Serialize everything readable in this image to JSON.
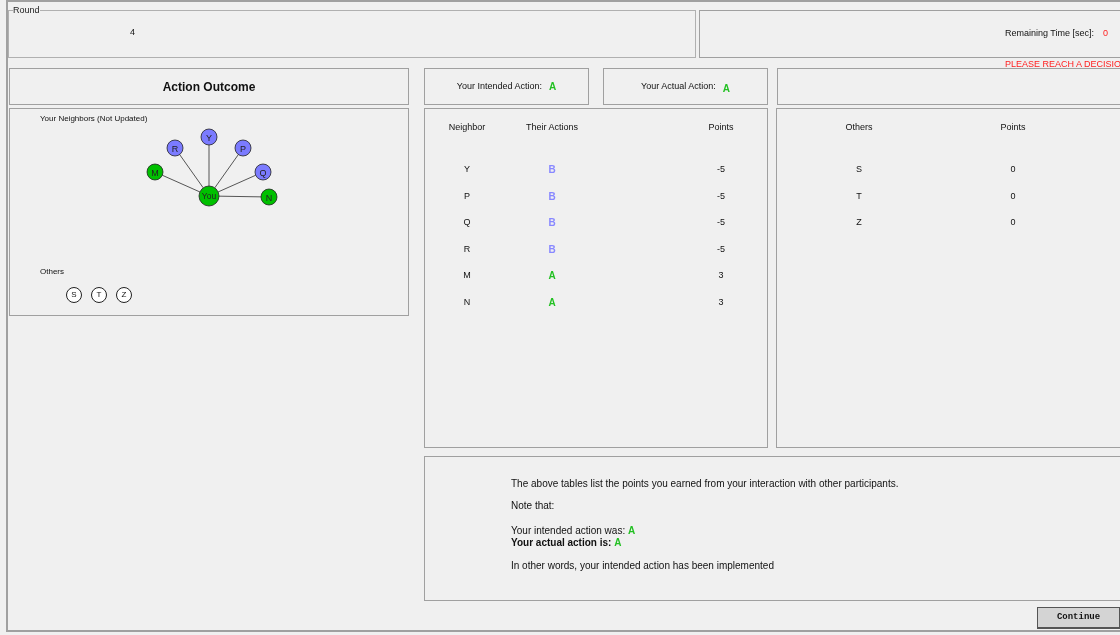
{
  "round": {
    "legend": "Round",
    "value": "4"
  },
  "timer": {
    "label": "Remaining Time [sec]:",
    "value": "0"
  },
  "warning": "PLEASE REACH A DECISIO",
  "outcome_title": "Action Outcome",
  "intended": {
    "label": "Your Intended Action:",
    "value": "A",
    "color": "#22c022"
  },
  "actual": {
    "label": "Your Actual Action:",
    "value": "A",
    "color": "#22c022"
  },
  "network": {
    "title": "Your Neighbors (Not Updated)",
    "center": {
      "label": "You",
      "color": "#00c000"
    },
    "neighbors": [
      {
        "label": "Y",
        "color": "#7b7bff"
      },
      {
        "label": "R",
        "color": "#7b7bff"
      },
      {
        "label": "P",
        "color": "#7b7bff"
      },
      {
        "label": "M",
        "color": "#00c000"
      },
      {
        "label": "Q",
        "color": "#7b7bff"
      },
      {
        "label": "N",
        "color": "#00c000"
      }
    ],
    "others_title": "Others",
    "others": [
      "S",
      "T",
      "Z"
    ]
  },
  "neighbor_table": {
    "columns": [
      "Neighbor",
      "Their Actions",
      "Points"
    ],
    "rows": [
      {
        "neighbor": "Y",
        "action": "B",
        "color": "#8888ff",
        "points": "-5"
      },
      {
        "neighbor": "P",
        "action": "B",
        "color": "#8888ff",
        "points": "-5"
      },
      {
        "neighbor": "Q",
        "action": "B",
        "color": "#8888ff",
        "points": "-5"
      },
      {
        "neighbor": "R",
        "action": "B",
        "color": "#8888ff",
        "points": "-5"
      },
      {
        "neighbor": "M",
        "action": "A",
        "color": "#22c022",
        "points": "3"
      },
      {
        "neighbor": "N",
        "action": "A",
        "color": "#22c022",
        "points": "3"
      }
    ]
  },
  "others_table": {
    "columns": [
      "Others",
      "Points"
    ],
    "rows": [
      {
        "name": "S",
        "points": "0"
      },
      {
        "name": "T",
        "points": "0"
      },
      {
        "name": "Z",
        "points": "0"
      }
    ]
  },
  "message": {
    "intro": "The above tables list the points you earned from your interaction with other participants.",
    "note": "Note that:",
    "results": [
      {
        "text": "Your intended action was:",
        "value": "A",
        "color": "#22c022",
        "bold": false
      },
      {
        "text": "Your actual action is:",
        "value": "A",
        "color": "#22c022",
        "bold": true
      }
    ],
    "conclusion": "In other words, your intended action has been implemented"
  },
  "continue_button": "Continue"
}
